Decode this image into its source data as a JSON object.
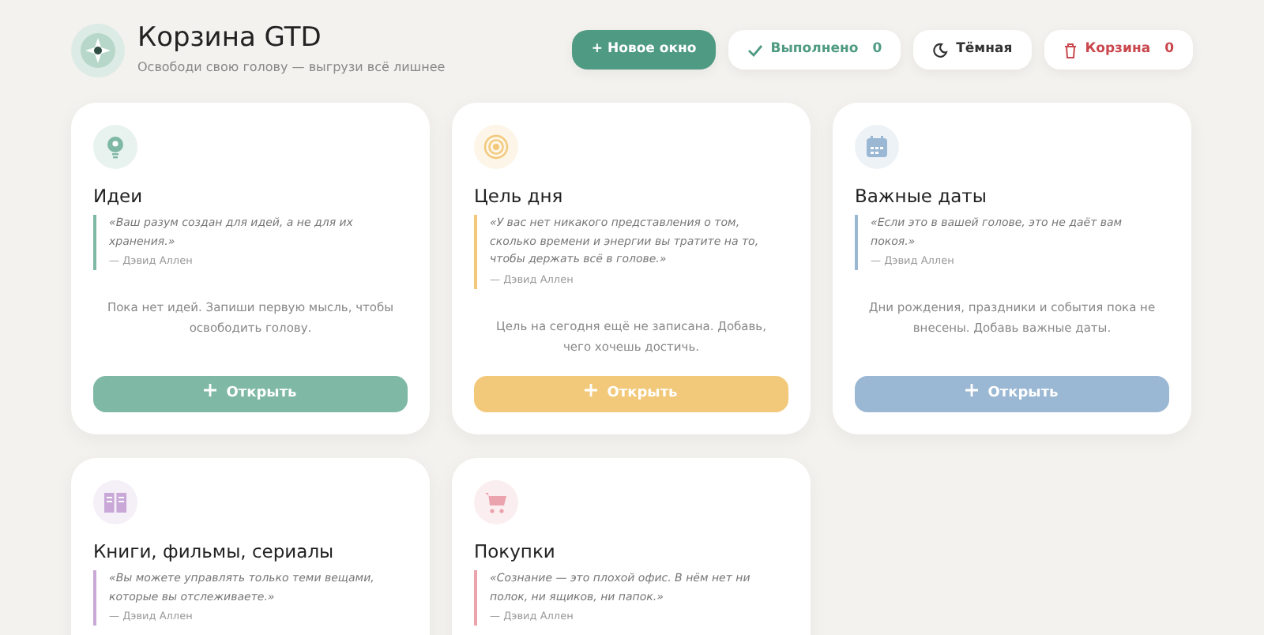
{
  "header": {
    "title": "Корзина GTD",
    "subtitle": "Освободи свою голову — выгрузи всё лишнее"
  },
  "actions": [
    {
      "kind": "new",
      "label": "+ Новое окно"
    },
    {
      "kind": "done",
      "label": "Выполнено",
      "count": "0"
    },
    {
      "kind": "theme",
      "label": "Тёмная"
    },
    {
      "kind": "trash",
      "label": "Корзина",
      "count": "0"
    }
  ],
  "cards": [
    {
      "kind": "bulb",
      "color": "#7fb8a4",
      "title": "Идеи",
      "quote": "«Ваш разум создан для идей, а не для их хранения.»",
      "author": "— Дэвид Аллен",
      "empty_text": "Пока нет идей. Запиши первую мысль, чтобы освободить голову.",
      "button": "Открыть"
    },
    {
      "kind": "target",
      "color": "#f2c97a",
      "title": "Цель дня",
      "quote": "«У вас нет никакого представления о том, сколько времени и энергии вы тратите на то, чтобы держать всё в голове.»",
      "author": "— Дэвид Аллен",
      "empty_text": "Цель на сегодня ещё не записана. Добавь, чего хочешь достичь.",
      "button": "Открыть"
    },
    {
      "kind": "calendar",
      "color": "#9ab7d3",
      "title": "Важные даты",
      "quote": "«Если это в вашей голове, это не даёт вам покоя.»",
      "author": "— Дэвид Аллен",
      "empty_text": "Дни рождения, праздники и события пока не внесены. Добавь важные даты.",
      "button": "Открыть"
    },
    {
      "kind": "book",
      "color": "#c9a8d8",
      "title": "Книги, фильмы, сериалы",
      "quote": "«Вы можете управлять только теми вещами, которые вы отслеживаете.»",
      "author": "— Дэвид Аллен"
    },
    {
      "kind": "cart",
      "color": "#eba3ad",
      "title": "Покупки",
      "quote": "«Сознание — это плохой офис. В нём нет ни полок, ни ящиков, ни папок.»",
      "author": "— Дэвид Аллен"
    }
  ]
}
